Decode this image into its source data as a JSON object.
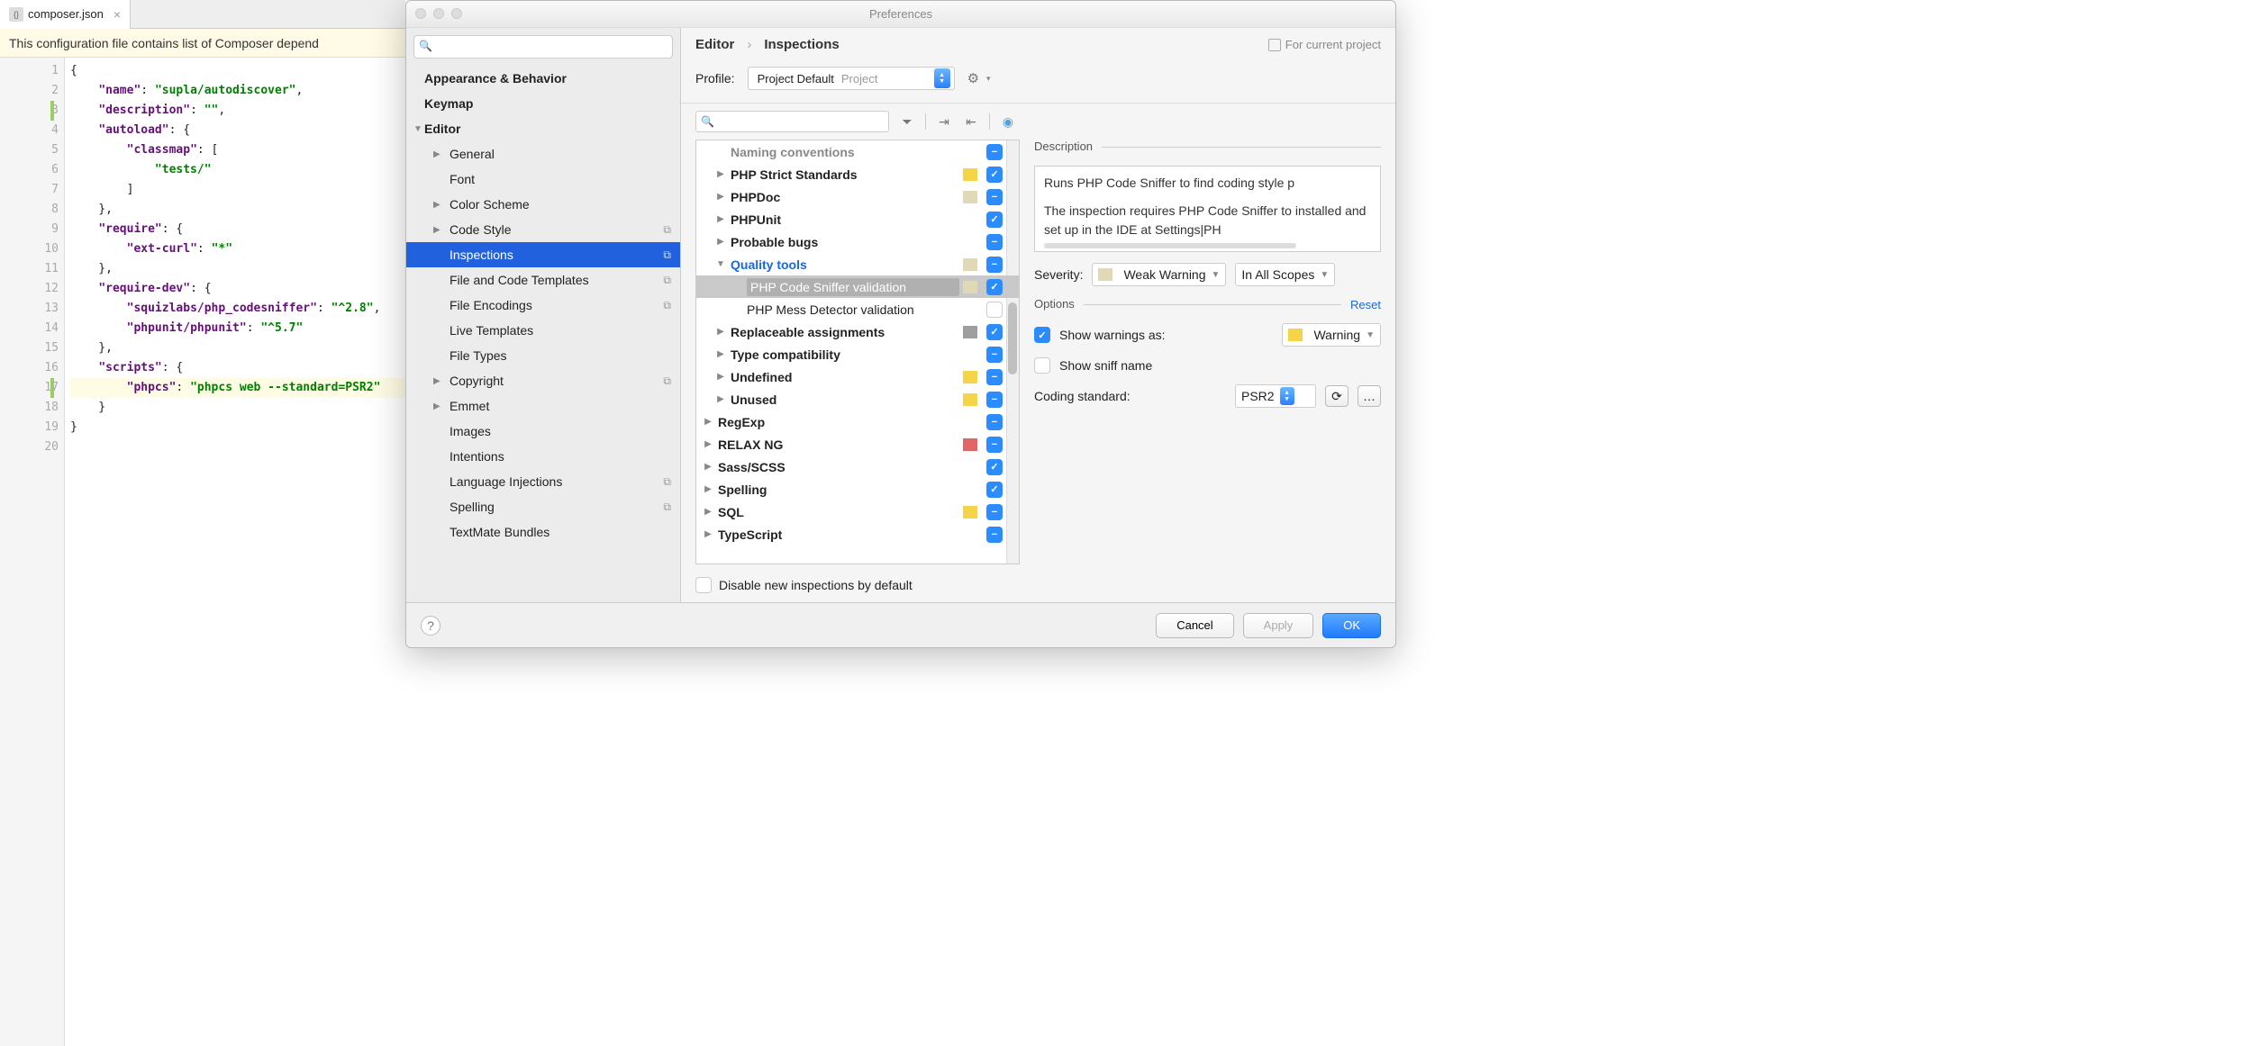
{
  "editor": {
    "tab_filename": "composer.json",
    "banner": "This configuration file contains list of Composer depend",
    "code_lines": [
      {
        "n": 1,
        "html": "<span class='brk'>{</span>"
      },
      {
        "n": 2,
        "html": "    <span class='kw'>\"name\"</span>: <span class='str'>\"supla/autodiscover\"</span>,"
      },
      {
        "n": 3,
        "html": "    <span class='kw'>\"description\"</span>: <span class='str'>\"\"</span>,"
      },
      {
        "n": 4,
        "html": "    <span class='kw'>\"autoload\"</span>: {"
      },
      {
        "n": 5,
        "html": "        <span class='kw'>\"classmap\"</span>: ["
      },
      {
        "n": 6,
        "html": "            <span class='str'>\"tests/\"</span>"
      },
      {
        "n": 7,
        "html": "        ]"
      },
      {
        "n": 8,
        "html": "    },"
      },
      {
        "n": 9,
        "html": "    <span class='kw'>\"require\"</span>: {"
      },
      {
        "n": 10,
        "html": "        <span class='kw'>\"ext-curl\"</span>: <span class='str'>\"*\"</span>"
      },
      {
        "n": 11,
        "html": "    },"
      },
      {
        "n": 12,
        "html": "    <span class='kw'>\"require-dev\"</span>: {"
      },
      {
        "n": 13,
        "html": "        <span class='kw'>\"squizlabs/php_codesniffer\"</span>: <span class='str'>\"^2.8\"</span>,"
      },
      {
        "n": 14,
        "html": "        <span class='kw'>\"phpunit/phpunit\"</span>: <span class='str'>\"^5.7\"</span>"
      },
      {
        "n": 15,
        "html": "    },"
      },
      {
        "n": 16,
        "html": "    <span class='kw'>\"scripts\"</span>: {"
      },
      {
        "n": 17,
        "html": "        <span class='kw'>\"phpcs\"</span>: <span class='str'>\"phpcs web --standard=PSR2\"</span>",
        "hl": true
      },
      {
        "n": 18,
        "html": "    }"
      },
      {
        "n": 19,
        "html": "}"
      },
      {
        "n": 20,
        "html": ""
      }
    ]
  },
  "prefs": {
    "title": "Preferences",
    "breadcrumb": [
      "Editor",
      "Inspections"
    ],
    "project_badge": "For current project",
    "profile_label": "Profile:",
    "profile_name": "Project Default",
    "profile_scope": "Project",
    "sidebar": [
      {
        "label": "Appearance & Behavior",
        "type": "top"
      },
      {
        "label": "Keymap",
        "type": "top"
      },
      {
        "label": "Editor",
        "type": "top",
        "expanded": true
      },
      {
        "label": "General",
        "type": "child",
        "arrow": true
      },
      {
        "label": "Font",
        "type": "child"
      },
      {
        "label": "Color Scheme",
        "type": "child",
        "arrow": true
      },
      {
        "label": "Code Style",
        "type": "child",
        "arrow": true,
        "copy": true
      },
      {
        "label": "Inspections",
        "type": "child",
        "selected": true,
        "copy": true
      },
      {
        "label": "File and Code Templates",
        "type": "child",
        "copy": true
      },
      {
        "label": "File Encodings",
        "type": "child",
        "copy": true
      },
      {
        "label": "Live Templates",
        "type": "child"
      },
      {
        "label": "File Types",
        "type": "child"
      },
      {
        "label": "Copyright",
        "type": "child",
        "arrow": true,
        "copy": true
      },
      {
        "label": "Emmet",
        "type": "child",
        "arrow": true
      },
      {
        "label": "Images",
        "type": "child"
      },
      {
        "label": "Intentions",
        "type": "child"
      },
      {
        "label": "Language Injections",
        "type": "child",
        "copy": true
      },
      {
        "label": "Spelling",
        "type": "child",
        "copy": true
      },
      {
        "label": "TextMate Bundles",
        "type": "child"
      }
    ],
    "inspections_tree": [
      {
        "level": 1,
        "arrow": "",
        "label": "Naming conventions",
        "bold": true,
        "sev": "",
        "check": "mixed",
        "cut": true
      },
      {
        "level": 1,
        "arrow": "▶",
        "label": "PHP Strict Standards",
        "bold": true,
        "sev": "yellow",
        "check": "on"
      },
      {
        "level": 1,
        "arrow": "▶",
        "label": "PHPDoc",
        "bold": true,
        "sev": "beige",
        "check": "mixed"
      },
      {
        "level": 1,
        "arrow": "▶",
        "label": "PHPUnit",
        "bold": true,
        "sev": "",
        "check": "on"
      },
      {
        "level": 1,
        "arrow": "▶",
        "label": "Probable bugs",
        "bold": true,
        "sev": "",
        "check": "mixed"
      },
      {
        "level": 1,
        "arrow": "▼",
        "label": "Quality tools",
        "blue": true,
        "sev": "beige",
        "check": "mixed"
      },
      {
        "level": 2,
        "arrow": "",
        "label": "PHP Code Sniffer validation",
        "sel": true,
        "sev": "beige",
        "check": "on"
      },
      {
        "level": 2,
        "arrow": "",
        "label": "PHP Mess Detector validation",
        "sev": "",
        "check": "off"
      },
      {
        "level": 1,
        "arrow": "▶",
        "label": "Replaceable assignments",
        "bold": true,
        "sev": "grey",
        "check": "on"
      },
      {
        "level": 1,
        "arrow": "▶",
        "label": "Type compatibility",
        "bold": true,
        "sev": "",
        "check": "mixed"
      },
      {
        "level": 1,
        "arrow": "▶",
        "label": "Undefined",
        "bold": true,
        "sev": "yellow",
        "check": "mixed"
      },
      {
        "level": 1,
        "arrow": "▶",
        "label": "Unused",
        "bold": true,
        "sev": "yellow",
        "check": "mixed"
      },
      {
        "level": 0,
        "arrow": "▶",
        "label": "RegExp",
        "bold": true,
        "sev": "",
        "check": "mixed"
      },
      {
        "level": 0,
        "arrow": "▶",
        "label": "RELAX NG",
        "bold": true,
        "sev": "red",
        "check": "mixed"
      },
      {
        "level": 0,
        "arrow": "▶",
        "label": "Sass/SCSS",
        "bold": true,
        "sev": "",
        "check": "on"
      },
      {
        "level": 0,
        "arrow": "▶",
        "label": "Spelling",
        "bold": true,
        "sev": "",
        "check": "on"
      },
      {
        "level": 0,
        "arrow": "▶",
        "label": "SQL",
        "bold": true,
        "sev": "yellow",
        "check": "mixed"
      },
      {
        "level": 0,
        "arrow": "▶",
        "label": "TypeScript",
        "bold": true,
        "sev": "",
        "check": "mixed"
      }
    ],
    "desc_label": "Description",
    "desc_text1": "Runs PHP Code Sniffer to find coding style p",
    "desc_text2": "The inspection requires PHP Code Sniffer to installed and set up in the IDE at Settings|PH",
    "severity_label": "Severity:",
    "severity_value": "Weak Warning",
    "scope_value": "In All Scopes",
    "options_label": "Options",
    "reset_link": "Reset",
    "show_warnings_label": "Show warnings as:",
    "show_warnings_value": "Warning",
    "show_sniff_label": "Show sniff name",
    "coding_std_label": "Coding standard:",
    "coding_std_value": "PSR2",
    "disable_new_label": "Disable new inspections by default",
    "buttons": {
      "cancel": "Cancel",
      "apply": "Apply",
      "ok": "OK"
    }
  }
}
